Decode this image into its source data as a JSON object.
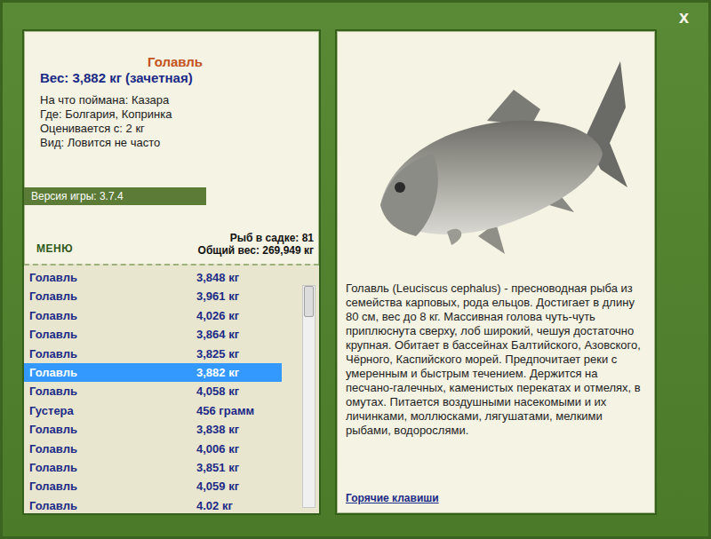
{
  "window": {
    "close": "x"
  },
  "fish": {
    "title": "Голавль",
    "weight": "Вес: 3,882 кг (зачетная)",
    "details": [
      "На что поймана: Казара",
      "Где: Болгария, Копринка",
      "Оценивается с: 2 кг",
      "Вид: Ловится не часто"
    ]
  },
  "version": "Версия игры: 3.7.4",
  "menu": "МЕНЮ",
  "stats": [
    "Рыб в садке: 81",
    "Общий вес: 269,949 кг"
  ],
  "catch_list": [
    {
      "name": "Голавль",
      "weight": "3,848 кг",
      "selected": false
    },
    {
      "name": "Голавль",
      "weight": "3,961 кг",
      "selected": false
    },
    {
      "name": "Голавль",
      "weight": "4,026 кг",
      "selected": false
    },
    {
      "name": "Голавль",
      "weight": "3,864 кг",
      "selected": false
    },
    {
      "name": "Голавль",
      "weight": "3,825 кг",
      "selected": false
    },
    {
      "name": "Голавль",
      "weight": "3,882 кг",
      "selected": true
    },
    {
      "name": "Голавль",
      "weight": "4,058 кг",
      "selected": false
    },
    {
      "name": "Густера",
      "weight": "456 грамм",
      "selected": false
    },
    {
      "name": "Голавль",
      "weight": "3,838 кг",
      "selected": false
    },
    {
      "name": "Голавль",
      "weight": "4,006 кг",
      "selected": false
    },
    {
      "name": "Голавль",
      "weight": "3,851 кг",
      "selected": false
    },
    {
      "name": "Голавль",
      "weight": "4,059 кг",
      "selected": false
    },
    {
      "name": "Голавль",
      "weight": "4.02 кг",
      "selected": false
    }
  ],
  "scrollbar": {
    "level": 0.14
  },
  "description": "Голавль (Leuciscus cephalus) - пресноводная рыба из семейства карповых, рода ельцов. Достигает в длину 80 см, вес до 8 кг. Массивная голова чуть-чуть приплюснута сверху, лоб широкий, чешуя достаточно крупная. Обитает в бассейнах Балтийского, Азовского, Чёрного, Каспийского морей. Предпочитает реки с умеренным и быстрым течением. Держится на песчано-галечных, каменистых перекатах и отмелях, в омутах. Питается воздушными насекомыми и их личинками, моллюсками, лягушатами, мелкими рыбами, водорослями.",
  "hotkeys": "Горячие клавиши"
}
